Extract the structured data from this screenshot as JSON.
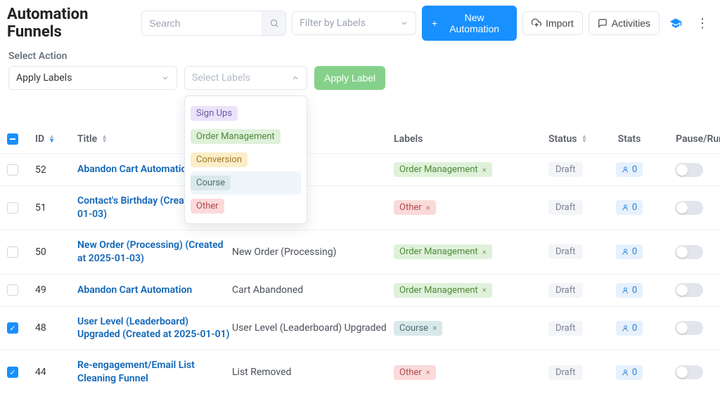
{
  "header": {
    "title": "Automation Funnels",
    "search_placeholder": "Search",
    "filter_placeholder": "Filter by Labels",
    "new_automation": "New Automation",
    "import": "Import",
    "activities": "Activities"
  },
  "actions": {
    "select_action_label": "Select Action",
    "apply_labels_text": "Apply Labels",
    "select_labels_placeholder": "Select Labels",
    "apply_label_btn": "Apply Label"
  },
  "dropdown_options": [
    {
      "text": "Sign Ups",
      "class": "c-signups"
    },
    {
      "text": "Order Management",
      "class": "c-ordermgmt"
    },
    {
      "text": "Conversion",
      "class": "c-conversion"
    },
    {
      "text": "Course",
      "class": "c-course"
    },
    {
      "text": "Other",
      "class": "c-other"
    }
  ],
  "columns": {
    "id": "ID",
    "title": "Title",
    "labels": "Labels",
    "status": "Status",
    "stats": "Stats",
    "pause_run": "Pause/Run"
  },
  "rows": [
    {
      "checked": false,
      "id": "52",
      "title": "Abandon Cart Automation",
      "trigger": "",
      "label_text": "Order Management",
      "label_class": "c-ordermgmt",
      "status": "Draft",
      "stats": "0"
    },
    {
      "checked": false,
      "id": "51",
      "title": "Contact's Birthday (Created at 25-01-03)",
      "trigger": "",
      "label_text": "Other",
      "label_class": "c-other",
      "status": "Draft",
      "stats": "0"
    },
    {
      "checked": false,
      "id": "50",
      "title": "New Order (Processing) (Created at 2025-01-03)",
      "trigger": "New Order (Processing)",
      "label_text": "Order Management",
      "label_class": "c-ordermgmt",
      "status": "Draft",
      "stats": "0"
    },
    {
      "checked": false,
      "id": "49",
      "title": "Abandon Cart Automation",
      "trigger": "Cart Abandoned",
      "label_text": "Order Management",
      "label_class": "c-ordermgmt",
      "status": "Draft",
      "stats": "0"
    },
    {
      "checked": true,
      "id": "48",
      "title": "User Level (Leaderboard) Upgraded (Created at 2025-01-01)",
      "trigger": "User Level (Leaderboard) Upgraded",
      "label_text": "Course",
      "label_class": "c-course",
      "status": "Draft",
      "stats": "0"
    },
    {
      "checked": true,
      "id": "44",
      "title": "Re-engagement/Email List Cleaning Funnel",
      "trigger": "List Removed",
      "label_text": "Other",
      "label_class": "c-other",
      "status": "Draft",
      "stats": "0"
    }
  ]
}
